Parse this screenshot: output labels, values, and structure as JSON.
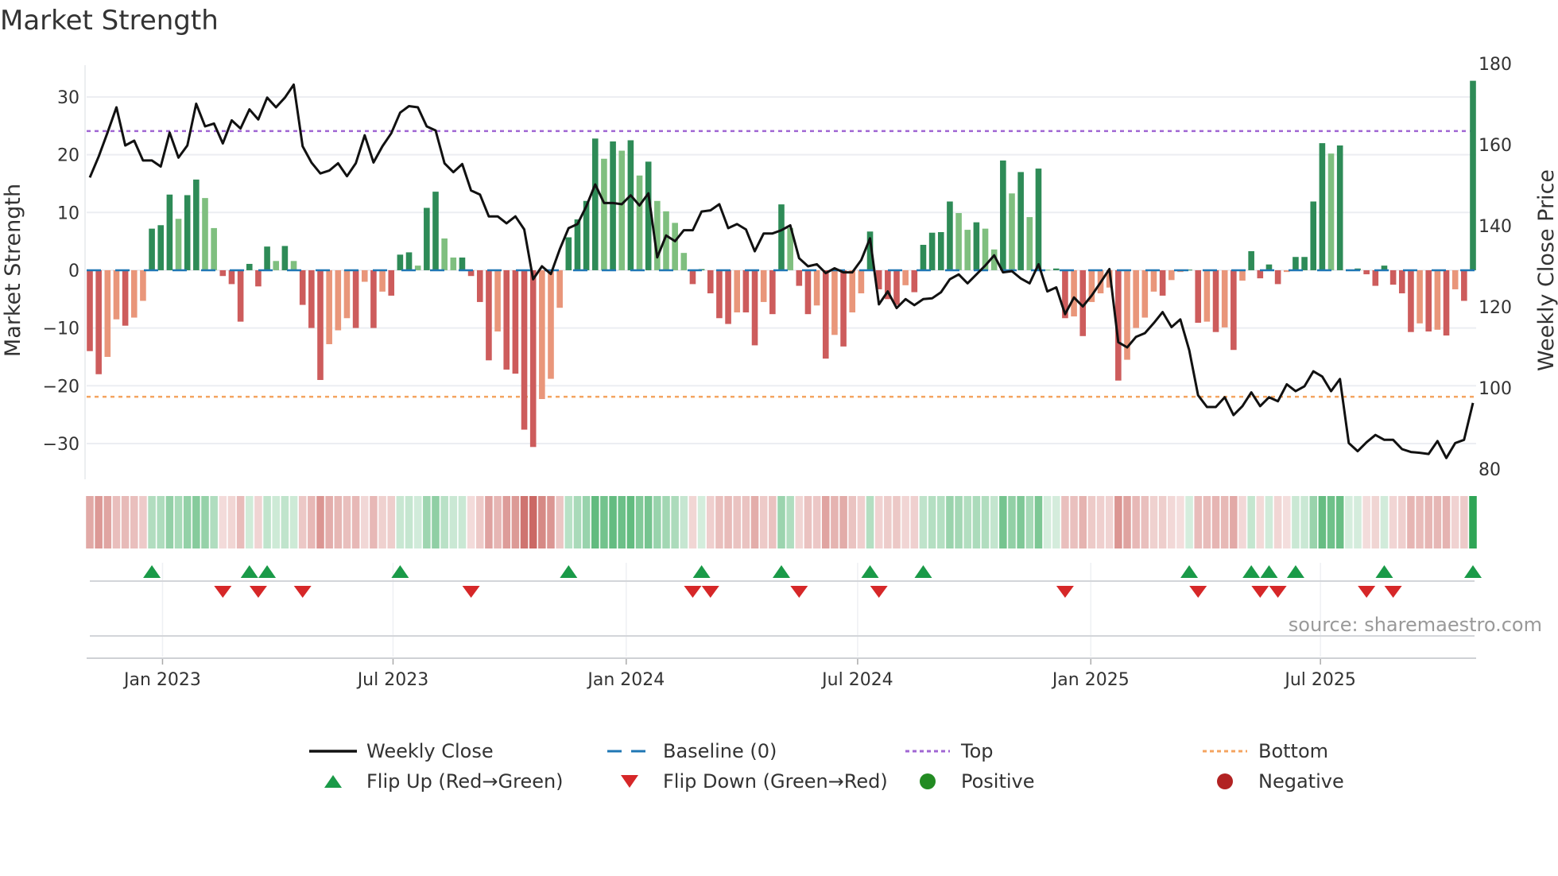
{
  "title": "Market Strength",
  "source": "source: sharemaestro.com",
  "legend": {
    "weekly_close": "Weekly Close",
    "baseline": "Baseline (0)",
    "top": "Top",
    "bottom": "Bottom",
    "flip_up": "Flip Up (Red→Green)",
    "flip_down": "Flip Down (Green→Red)",
    "positive": "Positive",
    "negative": "Negative"
  },
  "colors": {
    "pos_strong": "#2e8b57",
    "pos_weak": "#7fbf7f",
    "neg_strong": "#cd5c5c",
    "neg_weak": "#e9967a",
    "line": "#111111",
    "baseline": "#1f77b4",
    "top": "#a066d3",
    "bottom": "#f4a460",
    "flip_up": "#1a9a48",
    "flip_down": "#d62728",
    "positive": "#228b22",
    "negative": "#b22222"
  },
  "chart_data": {
    "type": "bar",
    "title": "Market Strength",
    "ylabel": "Market Strength",
    "y2label": "Weekly Close Price",
    "ylim": [
      -36.2,
      35.5
    ],
    "y2lim": [
      77.45,
      179.6
    ],
    "yticks": [
      -30,
      -20,
      -10,
      0,
      10,
      20,
      30
    ],
    "y2ticks": [
      80,
      100,
      120,
      140,
      160,
      180
    ],
    "xticks": [
      {
        "label": "Jan 2023",
        "week": 8.2
      },
      {
        "label": "Jul 2023",
        "week": 34.2
      },
      {
        "label": "Jan 2024",
        "week": 60.5
      },
      {
        "label": "Jul 2024",
        "week": 86.6
      },
      {
        "label": "Jan 2025",
        "week": 112.9
      },
      {
        "label": "Jul 2025",
        "week": 138.8
      }
    ],
    "top_level": 24.1,
    "bottom_level": -21.9,
    "baseline": 0,
    "strength": [
      -14,
      -18,
      -15,
      -8.5,
      -9.6,
      -8.2,
      -5.3,
      7.2,
      7.8,
      13.1,
      8.9,
      13,
      15.7,
      12.5,
      7.3,
      -1,
      -2.4,
      -8.9,
      1.1,
      -2.8,
      4.1,
      1.6,
      4.2,
      1.6,
      -6,
      -10,
      -19,
      -12.8,
      -10.4,
      -8.3,
      -10,
      -2,
      -10,
      -3.7,
      -4.4,
      2.7,
      3.1,
      0.8,
      10.8,
      13.6,
      5.5,
      2.2,
      2.2,
      -1,
      -5.5,
      -15.6,
      -10.6,
      -17.2,
      -17.9,
      -27.6,
      -30.6,
      -22.3,
      -18.8,
      -6.5,
      5.7,
      8.8,
      12,
      22.8,
      19.3,
      22.3,
      20.7,
      22.5,
      16.4,
      18.8,
      12,
      10.2,
      8.2,
      3,
      -2.4,
      0.2,
      -4,
      -8.3,
      -9.3,
      -7.3,
      -7.3,
      -13,
      -5.5,
      -7.6,
      11.4,
      7.3,
      -2.7,
      -7.6,
      -6.1,
      -15.3,
      -11.2,
      -13.2,
      -7.3,
      -4,
      6.7,
      -3.3,
      -5,
      -6,
      -2.6,
      -3.8,
      4.4,
      6.5,
      6.6,
      11.9,
      9.9,
      7,
      8.3,
      7.2,
      3.6,
      19,
      13.3,
      17,
      9.2,
      17.6,
      0.1,
      0.3,
      -8.3,
      -8,
      -11.4,
      -5.5,
      -4,
      -3,
      -19.1,
      -15.5,
      -10,
      -8.2,
      -3.7,
      -4.4,
      -1.7,
      -0.3,
      0.1,
      -9.1,
      -8.9,
      -10.7,
      -9.9,
      -13.8,
      -1.8,
      3.3,
      -1.4,
      1,
      -2.4,
      -0.3,
      2.3,
      2.3,
      11.9,
      22,
      20.2,
      21.6,
      0.1,
      0.3,
      -0.7,
      -2.7,
      0.8,
      -2.5,
      -4,
      -10.7,
      -9.2,
      -10.6,
      -10.3,
      -11.3,
      -3.3,
      -5.3,
      32.8
    ],
    "close": [
      151.9,
      157.1,
      163,
      169.2,
      159.8,
      161,
      156.1,
      156.1,
      154.6,
      163,
      156.8,
      159.8,
      170.1,
      164.5,
      165.2,
      160.3,
      166,
      164,
      168.7,
      166.2,
      171.6,
      169.2,
      171.6,
      174.8,
      159.6,
      155.6,
      152.9,
      153.6,
      155.4,
      152.2,
      155.4,
      162.3,
      155.6,
      159.6,
      162.8,
      167.9,
      169.5,
      169.2,
      164.5,
      163.5,
      155.4,
      153.2,
      155.2,
      148.7,
      147.7,
      142.3,
      142.3,
      140.6,
      142.3,
      139.1,
      126.8,
      130,
      128.1,
      134.2,
      139.4,
      140.4,
      144.8,
      150.2,
      145.6,
      145.6,
      145.3,
      147.5,
      145,
      148,
      132.2,
      137.6,
      136.2,
      138.9,
      138.9,
      143.5,
      143.8,
      145.3,
      139.4,
      140.4,
      139.1,
      133.7,
      138.1,
      138.1,
      138.9,
      140.1,
      132,
      130,
      130.5,
      128.3,
      129.5,
      128.5,
      128.5,
      131.5,
      136.9,
      120.6,
      123.8,
      119.7,
      121.9,
      120.4,
      121.9,
      122.1,
      123.6,
      126.8,
      128,
      125.8,
      128,
      130.2,
      132.7,
      128.5,
      128.8,
      127,
      125.8,
      130.5,
      123.8,
      124.8,
      118.2,
      122.3,
      120.1,
      122.8,
      126,
      129.3,
      111.3,
      110,
      112.6,
      113.5,
      116,
      118.7,
      115,
      116.9,
      109.3,
      98.2,
      95.3,
      95.3,
      97.7,
      93.3,
      95.5,
      98.9,
      95.5,
      97.7,
      96.7,
      100.9,
      99.2,
      100.4,
      104.1,
      102.8,
      99.2,
      102.2,
      86.4,
      84.4,
      86.6,
      88.4,
      87.2,
      87.2,
      84.9,
      84.2,
      84,
      83.7,
      86.9,
      82.7,
      86.4,
      87.2,
      96.3
    ]
  }
}
